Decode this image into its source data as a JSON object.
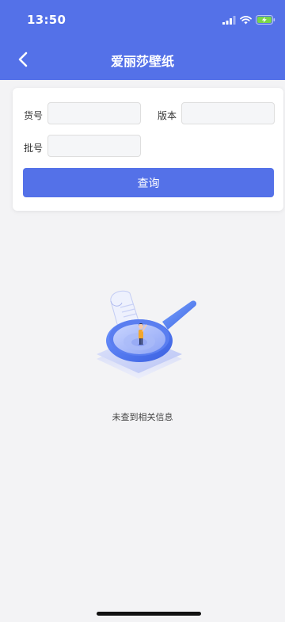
{
  "status_bar": {
    "time": "13:50"
  },
  "nav": {
    "title": "爱丽莎壁纸",
    "back_icon": "chevron-left-icon"
  },
  "form": {
    "item_no_label": "货号",
    "item_no_value": "",
    "version_label": "版本",
    "version_value": "",
    "batch_label": "批号",
    "batch_value": "",
    "query_button": "查询"
  },
  "empty_state": {
    "message": "未查到相关信息",
    "icon": "magnifier-search-illustration"
  },
  "colors": {
    "primary": "#5471e8",
    "background": "#f3f3f5",
    "card": "#ffffff"
  }
}
